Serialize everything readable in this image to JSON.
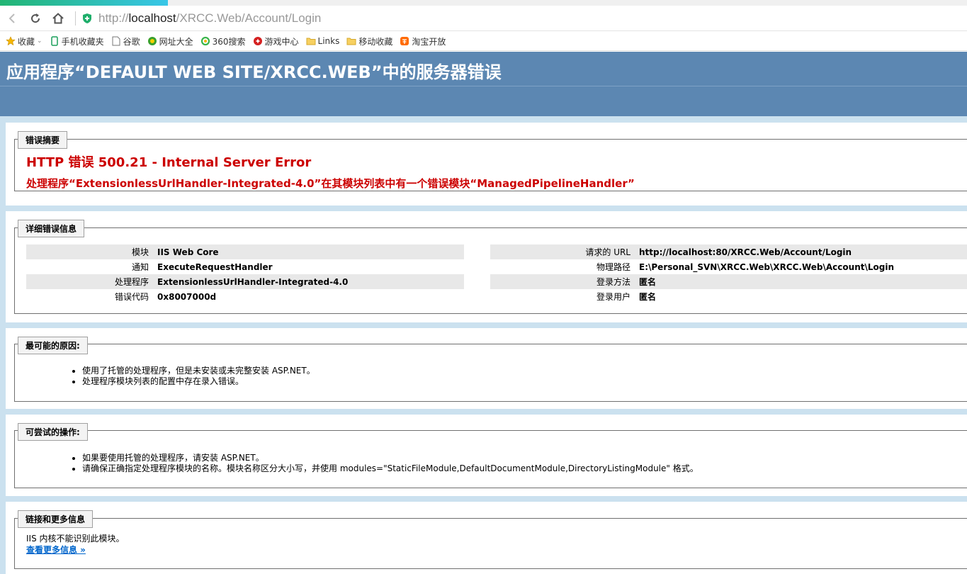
{
  "browser": {
    "url_scheme_host_prefix": "http://",
    "url_host": "localhost",
    "url_path": "/XRCC.Web/Account/Login",
    "bookmarks": [
      {
        "label": "收藏",
        "icon": "star-icon"
      },
      {
        "label": "手机收藏夹",
        "icon": "phone-icon"
      },
      {
        "label": "谷歌",
        "icon": "page-icon"
      },
      {
        "label": "网址大全",
        "icon": "globe-icon"
      },
      {
        "label": "360搜索",
        "icon": "search-360-icon"
      },
      {
        "label": "游戏中心",
        "icon": "game-icon"
      },
      {
        "label": "Links",
        "icon": "folder-icon"
      },
      {
        "label": "移动收藏",
        "icon": "folder-icon"
      },
      {
        "label": "淘宝开放",
        "icon": "taobao-icon"
      }
    ]
  },
  "page": {
    "title": "应用程序“DEFAULT WEB SITE/XRCC.WEB”中的服务器错误",
    "summary": {
      "legend": "错误摘要",
      "title": "HTTP 错误 500.21 - Internal Server Error",
      "message": "处理程序“ExtensionlessUrlHandler-Integrated-4.0”在其模块列表中有一个错误模块“ManagedPipelineHandler”"
    },
    "details": {
      "legend": "详细错误信息",
      "left": [
        {
          "key": "模块",
          "value": "IIS Web Core"
        },
        {
          "key": "通知",
          "value": "ExecuteRequestHandler"
        },
        {
          "key": "处理程序",
          "value": "ExtensionlessUrlHandler-Integrated-4.0"
        },
        {
          "key": "错误代码",
          "value": "0x8007000d"
        }
      ],
      "right": [
        {
          "key": "请求的 URL",
          "value": "http://localhost:80/XRCC.Web/Account/Login"
        },
        {
          "key": "物理路径",
          "value": "E:\\Personal_SVN\\XRCC.Web\\XRCC.Web\\Account\\Login"
        },
        {
          "key": "登录方法",
          "value": "匿名"
        },
        {
          "key": "登录用户",
          "value": "匿名"
        }
      ]
    },
    "causes": {
      "legend": "最可能的原因:",
      "items": [
        "使用了托管的处理程序，但是未安装或未完整安装 ASP.NET。",
        "处理程序模块列表的配置中存在录入错误。"
      ]
    },
    "actions": {
      "legend": "可尝试的操作:",
      "items": [
        "如果要使用托管的处理程序，请安装 ASP.NET。",
        "请确保正确指定处理程序模块的名称。模块名称区分大小写，并使用 modules=\"StaticFileModule,DefaultDocumentModule,DirectoryListingModule\" 格式。"
      ]
    },
    "links": {
      "legend": "链接和更多信息",
      "text": "IIS 内核不能识别此模块。",
      "more": "查看更多信息 »"
    }
  },
  "colors": {
    "header": "#5c87b2",
    "error": "#cc0000",
    "link": "#0066cc",
    "background": "#cbe1ef"
  }
}
